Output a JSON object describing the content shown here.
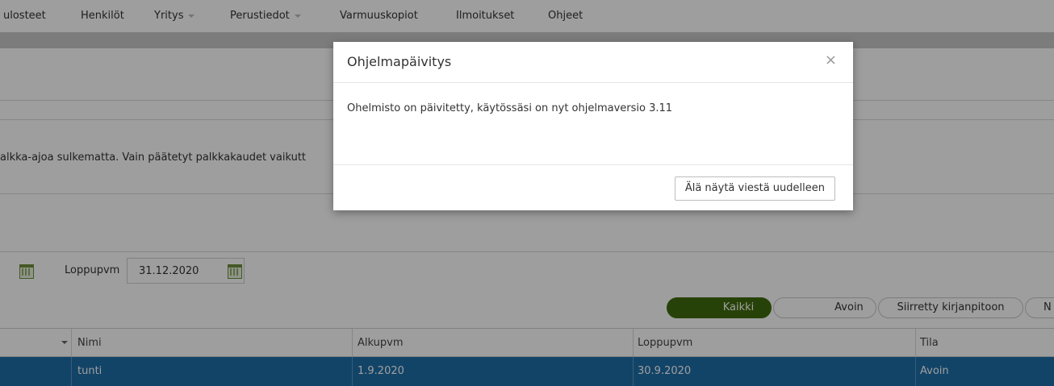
{
  "menu": {
    "items": [
      {
        "label": "ulosteet",
        "caret": false
      },
      {
        "label": "Henkilöt",
        "caret": false
      },
      {
        "label": "Yritys",
        "caret": true
      },
      {
        "label": "Perustiedot",
        "caret": true
      },
      {
        "label": "Varmuuskopiot",
        "caret": false
      },
      {
        "label": "Ilmoitukset",
        "caret": false
      },
      {
        "label": "Ohjeet",
        "caret": false
      }
    ]
  },
  "info_text": "alkka-ajoa sulkematta. Vain päätetyt palkkakaudet vaikutt",
  "filters": {
    "end_date_label": "Loppupvm",
    "end_date_value": "31.12.2020"
  },
  "status_filters": [
    "Kaikki",
    "Avoin",
    "Siirretty kirjanpitoon",
    "N"
  ],
  "table": {
    "columns": [
      "Nimi",
      "Alkupvm",
      "Loppupvm",
      "Tila"
    ],
    "rows": [
      {
        "nimi": "tunti",
        "alkupvm": "1.9.2020",
        "loppupvm": "30.9.2020",
        "tila": "Avoin"
      }
    ]
  },
  "dialog": {
    "title": "Ohjelmapäivitys",
    "close_symbol": "×",
    "message": "Ohelmisto on päivitetty, käytössäsi on nyt ohjelmaversio 3.11",
    "button_label": "Älä näytä viestä uudelleen"
  },
  "colors": {
    "active_filter": "#3f6b0e",
    "selected_row": "#1d6fa8",
    "calendar_icon": "#6f8f3c"
  }
}
